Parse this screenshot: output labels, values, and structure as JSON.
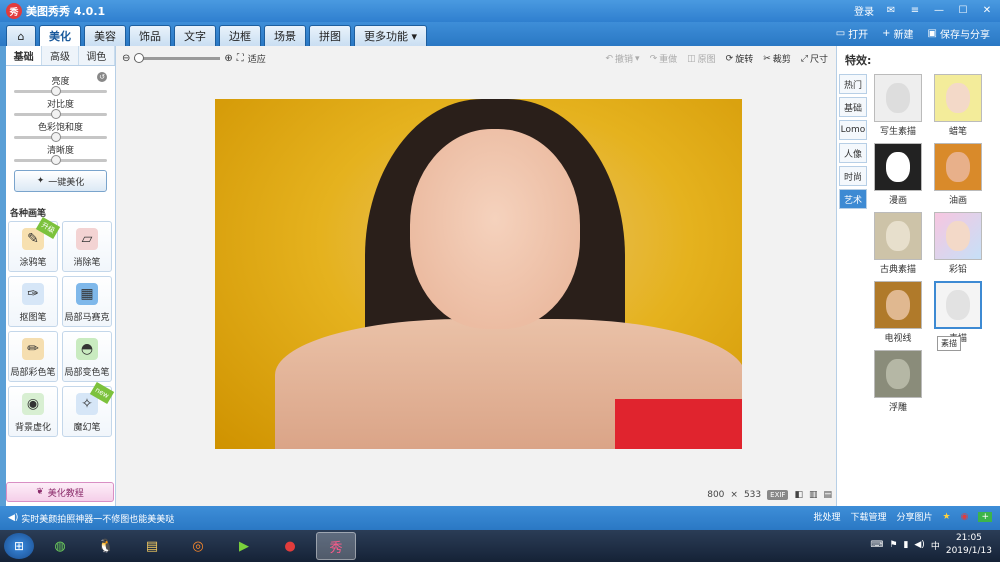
{
  "title": {
    "logo_text": "秀",
    "text": "美图秀秀 4.0.1",
    "login": "登录"
  },
  "menu": {
    "tabs": [
      "美化",
      "美容",
      "饰品",
      "文字",
      "边框",
      "场景",
      "拼图",
      "更多功能"
    ],
    "active_tab": "美化",
    "open": "打开",
    "new": "新建",
    "save_share": "保存与分享"
  },
  "left": {
    "subtabs": [
      "基础",
      "高级",
      "调色"
    ],
    "sliders": [
      {
        "label": "亮度",
        "level": 0.45
      },
      {
        "label": "对比度",
        "level": 0.45
      },
      {
        "label": "色彩饱和度",
        "level": 0.45
      },
      {
        "label": "清晰度",
        "level": 0.45
      }
    ],
    "one_click": "一键美化",
    "brush_title": "各种画笔",
    "brushes": [
      {
        "label": "涂鸦笔",
        "icon": "pen-icon",
        "badge": "升级"
      },
      {
        "label": "消除笔",
        "icon": "eraser-icon",
        "badge": ""
      },
      {
        "label": "抠图笔",
        "icon": "cutout-pen-icon",
        "badge": ""
      },
      {
        "label": "局部马赛克",
        "icon": "mosaic-icon",
        "badge": ""
      },
      {
        "label": "局部彩色笔",
        "icon": "color-brush-icon",
        "badge": ""
      },
      {
        "label": "局部变色笔",
        "icon": "bucket-icon",
        "badge": ""
      },
      {
        "label": "背景虚化",
        "icon": "blur-icon",
        "badge": ""
      },
      {
        "label": "魔幻笔",
        "icon": "magic-pen-icon",
        "badge": "new"
      }
    ],
    "tutorial": "美化教程"
  },
  "toolbar": {
    "fit": "适应",
    "undo": "撤销",
    "redo": "重做",
    "original": "原图",
    "rotate": "旋转",
    "crop": "裁剪",
    "size": "尺寸",
    "zoom_level": 0.0
  },
  "status": {
    "width": "800",
    "times": "×",
    "height": "533",
    "exif": "EXIF"
  },
  "right": {
    "title": "特效:",
    "categories": [
      "热门",
      "基础",
      "Lomo",
      "人像",
      "时尚",
      "艺术"
    ],
    "active_category": "艺术",
    "effects": [
      "写生素描",
      "蜡笔",
      "漫画",
      "油画",
      "古典素描",
      "彩铅",
      "电视线",
      "素描",
      "浮雕"
    ],
    "selected_effect": "素描",
    "tooltip": "素描"
  },
  "infobar": {
    "message": "实时美颜拍照神器一不修图也能美美哒",
    "batch": "批处理",
    "download": "下载管理",
    "share": "分享图片"
  },
  "taskbar": {
    "time": "21:05",
    "date": "2019/1/13"
  },
  "colors": {
    "accent": "#2f7fcf",
    "panel_bg": "#ffffff",
    "photo_bg": "#e5b21e"
  }
}
